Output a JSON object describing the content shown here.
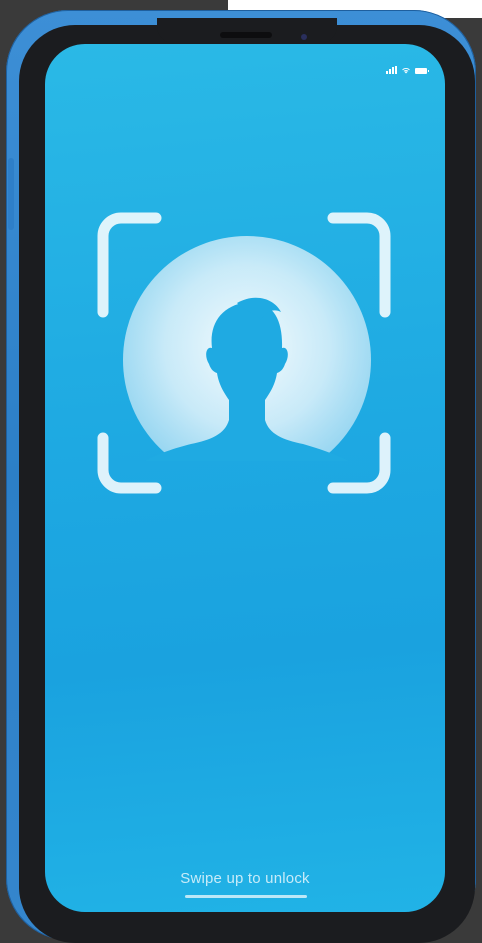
{
  "lock_screen": {
    "hint_text": "Swipe up to unlock",
    "status_bar": {
      "signal_icon": "cellular-signal-icon",
      "wifi_icon": "wifi-icon",
      "battery_icon": "battery-icon"
    },
    "face_id_icon": "face-id-scan-icon",
    "colors": {
      "frame": "#3d8fd6",
      "screen_top": "#2ab9e6",
      "screen_bottom": "#1aa2df",
      "bezel": "#1b1c1f"
    }
  }
}
